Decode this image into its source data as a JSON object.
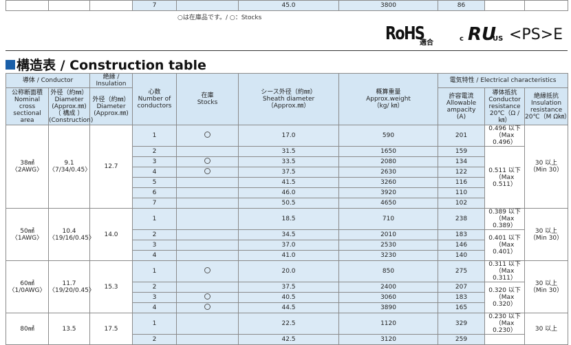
{
  "top_fragment": {
    "cores": "7",
    "sheath": "45.0",
    "weight": "3800",
    "ampacity": "86"
  },
  "stock_note": "○は在庫品です。/ ○：Stocks",
  "logos": {
    "rohs": "RoHS",
    "rohs_sub": "適合",
    "cul": "RU",
    "cul_c": "c",
    "cul_us": "US",
    "pse": "<PS>E"
  },
  "section_title": "構造表 / Construction table",
  "headers": {
    "conductor_group": "導体 / Conductor",
    "insulation_group": "絶縁 / Insulation",
    "electrical_group": "電気特性 / Electrical characteristics",
    "nominal": [
      "公称断面積",
      "Nominal cross",
      "sectional area"
    ],
    "diameter": [
      "外径（約㎜）",
      "Diameter",
      "(Approx.㎜)",
      "（ 構成 ）",
      "(Construction)"
    ],
    "ins_diameter": [
      "外径（約㎜）",
      "Diameter",
      "(Approx.㎜)"
    ],
    "cores": [
      "心数",
      "Number of",
      "conductors"
    ],
    "stock": [
      "在庫",
      "Stocks"
    ],
    "sheath": [
      "シース外径（約㎜）",
      "Sheath diameter",
      "（Approx.㎜）"
    ],
    "weight": [
      "概算重量",
      "Approx.weight",
      "（kg/ ㎞）"
    ],
    "ampacity": [
      "許容電流",
      "Allowable",
      "ampacity",
      "(A)"
    ],
    "resistance": [
      "導体抵抗",
      "Conductor",
      "resistance",
      "20℃（Ω / ㎞）"
    ],
    "ins_resistance": [
      "絶縁抵抗",
      "Insulation",
      "resistance",
      "20℃（M Ω㎞）"
    ]
  },
  "groups": [
    {
      "size": [
        "38㎟",
        "〈2AWG〉"
      ],
      "dia": [
        "9.1",
        "〈7/34/0.45〉"
      ],
      "ins": "12.7",
      "insres": [
        "30 以上",
        "（Min 30）"
      ],
      "rows": [
        {
          "c": "1",
          "s": true,
          "sh": "17.0",
          "w": "590",
          "a": "201"
        },
        {
          "c": "2",
          "s": false,
          "sh": "31.5",
          "w": "1650",
          "a": "159"
        },
        {
          "c": "3",
          "s": true,
          "sh": "33.5",
          "w": "2080",
          "a": "134"
        },
        {
          "c": "4",
          "s": true,
          "sh": "37.5",
          "w": "2630",
          "a": "122"
        },
        {
          "c": "5",
          "s": false,
          "sh": "41.5",
          "w": "3260",
          "a": "116"
        },
        {
          "c": "6",
          "s": false,
          "sh": "46.0",
          "w": "3920",
          "a": "110"
        },
        {
          "c": "7",
          "s": false,
          "sh": "50.5",
          "w": "4650",
          "a": "102"
        }
      ],
      "res": [
        {
          "span": 1,
          "t": [
            "0.496 以下",
            "（Max 0.496）"
          ]
        },
        {
          "span": 6,
          "t": [
            "0.511 以下",
            "（Max 0.511）"
          ]
        }
      ]
    },
    {
      "size": [
        "50㎟",
        "〈1AWG〉"
      ],
      "dia": [
        "10.4",
        "〈19/16/0.45〉"
      ],
      "ins": "14.0",
      "insres": [
        "30 以上",
        "（Min 30）"
      ],
      "rows": [
        {
          "c": "1",
          "s": false,
          "sh": "18.5",
          "w": "710",
          "a": "238"
        },
        {
          "c": "2",
          "s": false,
          "sh": "34.5",
          "w": "2010",
          "a": "183"
        },
        {
          "c": "3",
          "s": false,
          "sh": "37.0",
          "w": "2530",
          "a": "146"
        },
        {
          "c": "4",
          "s": false,
          "sh": "41.0",
          "w": "3230",
          "a": "140"
        }
      ],
      "res": [
        {
          "span": 1,
          "t": [
            "0.389 以下",
            "（Max 0.389）"
          ]
        },
        {
          "span": 3,
          "t": [
            "0.401 以下",
            "（Max 0.401）"
          ]
        }
      ]
    },
    {
      "size": [
        "60㎟",
        "〈1/0AWG〉"
      ],
      "dia": [
        "11.7",
        "〈19/20/0.45〉"
      ],
      "ins": "15.3",
      "insres": [
        "30 以上",
        "（Min 30）"
      ],
      "rows": [
        {
          "c": "1",
          "s": true,
          "sh": "20.0",
          "w": "850",
          "a": "275"
        },
        {
          "c": "2",
          "s": false,
          "sh": "37.5",
          "w": "2400",
          "a": "207"
        },
        {
          "c": "3",
          "s": true,
          "sh": "40.5",
          "w": "3060",
          "a": "183"
        },
        {
          "c": "4",
          "s": true,
          "sh": "44.5",
          "w": "3890",
          "a": "165"
        }
      ],
      "res": [
        {
          "span": 1,
          "t": [
            "0.311 以下",
            "（Max 0.311）"
          ]
        },
        {
          "span": 3,
          "t": [
            "0.320 以下",
            "（Max 0.320）"
          ]
        }
      ]
    },
    {
      "size": [
        "80㎟",
        ""
      ],
      "dia": [
        "13.5",
        ""
      ],
      "ins": "17.5",
      "insres": [
        "30 以上",
        ""
      ],
      "rows": [
        {
          "c": "1",
          "s": false,
          "sh": "22.5",
          "w": "1120",
          "a": "329"
        },
        {
          "c": "2",
          "s": false,
          "sh": "42.5",
          "w": "3120",
          "a": "259"
        }
      ],
      "res": [
        {
          "span": 1,
          "t": [
            "0.230 以下",
            "（Max 0.230）"
          ]
        },
        {
          "span": 1,
          "t": [
            "",
            ""
          ]
        }
      ]
    }
  ]
}
